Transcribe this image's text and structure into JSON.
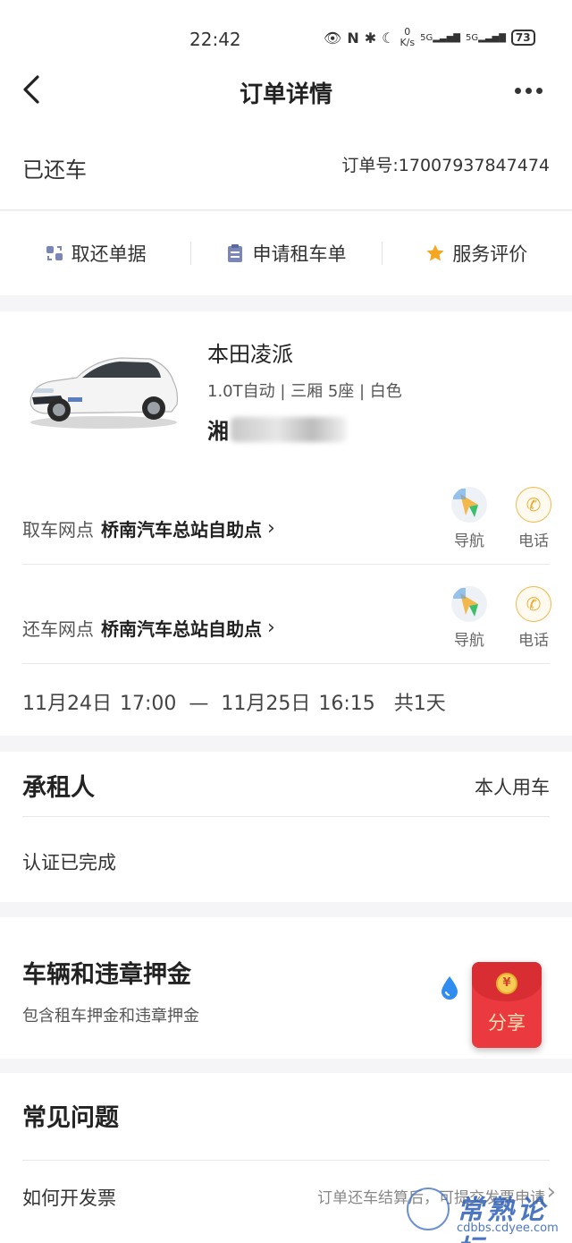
{
  "status_bar": {
    "time": "22:42",
    "net_speed_value": "0",
    "net_speed_unit": "K/s",
    "signal_1": "5G",
    "signal_2": "5G",
    "battery": "73"
  },
  "header": {
    "title": "订单详情"
  },
  "order": {
    "status": "已还车",
    "number": "订单号:17007937847474"
  },
  "actions": [
    {
      "label": "取还单据",
      "icon": "receipt-icon"
    },
    {
      "label": "申请租车单",
      "icon": "clipboard-icon"
    },
    {
      "label": "服务评价",
      "icon": "star-icon"
    }
  ],
  "car": {
    "name": "本田凌派",
    "specs": "1.0T自动 | 三厢 5座 | 白色",
    "plate_prefix": "湘"
  },
  "pickup": {
    "label": "取车网点",
    "station": "桥南汽车总站自助点",
    "nav_label": "导航",
    "phone_label": "电话"
  },
  "return": {
    "label": "还车网点",
    "station": "桥南汽车总站自助点",
    "nav_label": "导航",
    "phone_label": "电话"
  },
  "dates": {
    "start": "11月24日 17:00",
    "separator": "—",
    "end": "11月25日 16:15",
    "duration": "共1天"
  },
  "renter": {
    "title": "承租人",
    "type": "本人用车",
    "status": "认证已完成"
  },
  "deposit": {
    "title": "车辆和违章押金",
    "description": "包含租车押金和违章押金"
  },
  "faq": {
    "title": "常见问题",
    "item": "如何开发票",
    "hint": "订单还车结算后，可提交发票申请"
  },
  "share": {
    "label": "分享",
    "coin": "¥"
  },
  "watermark": {
    "title": "常熟论坛",
    "url": "cdbbs.cdyee.com"
  },
  "colors": {
    "accent_star": "#f5a623",
    "phone": "#f0a92a",
    "share_red": "#ea3a3f",
    "deposit_blue": "#2f8cf0"
  }
}
